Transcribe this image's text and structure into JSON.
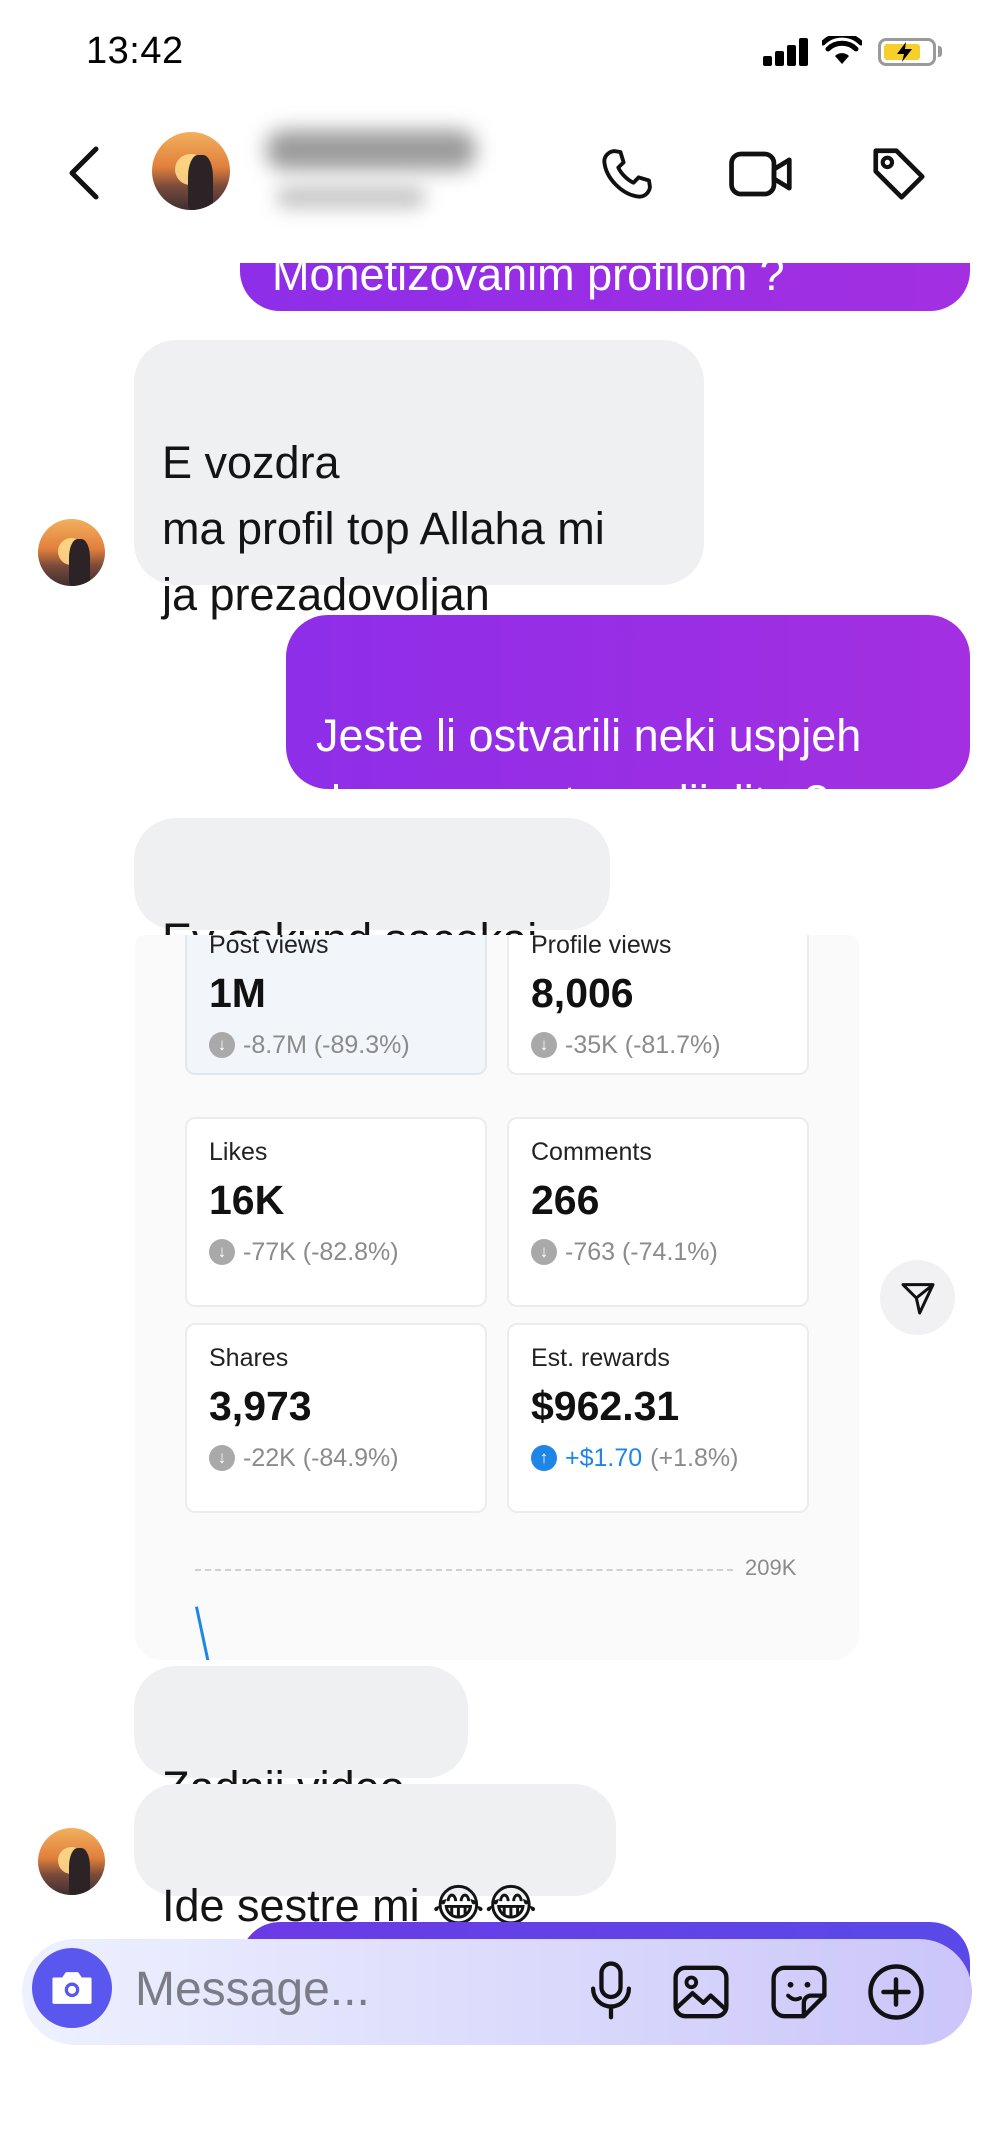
{
  "status_bar": {
    "time": "13:42"
  },
  "header": {
    "back_icon": "chevron-left-icon",
    "call_icon": "phone-icon",
    "video_icon": "video-camera-icon",
    "tag_icon": "tag-icon"
  },
  "messages": [
    {
      "side": "sent",
      "text": "Monetizovanim profilom ?",
      "partial": true
    },
    {
      "side": "received",
      "text": "E vozdra\nma profil top Allaha mi\nja prezadovoljan"
    },
    {
      "side": "sent",
      "text": "Jeste li ostvarili neki uspjeh\nda sa nama to podijelite ?"
    },
    {
      "side": "received",
      "text": "Ev sekund sacekaj"
    },
    {
      "side": "received",
      "text": "Zadnji video"
    },
    {
      "side": "received",
      "text": "Ide sestre mi 😂😂"
    }
  ],
  "shared_screenshot": {
    "stats": [
      {
        "label": "Post views",
        "value": "1M",
        "delta": "-8.7M (-89.3%)",
        "direction": "down"
      },
      {
        "label": "Profile views",
        "value": "8,006",
        "delta": "-35K (-81.7%)",
        "direction": "down"
      },
      {
        "label": "Likes",
        "value": "16K",
        "delta": "-77K (-82.8%)",
        "direction": "down"
      },
      {
        "label": "Comments",
        "value": "266",
        "delta": "-763 (-74.1%)",
        "direction": "down"
      },
      {
        "label": "Shares",
        "value": "3,973",
        "delta": "-22K (-84.9%)",
        "direction": "down"
      },
      {
        "label": "Est. rewards",
        "value": "$962.31",
        "delta_main": "+$1.70",
        "delta_pct": "(+1.8%)",
        "direction": "up"
      }
    ],
    "chart_axis_label": "209K"
  },
  "share_icon": "send-icon",
  "composer": {
    "placeholder": "Message...",
    "icons": [
      "camera-icon",
      "microphone-icon",
      "image-icon",
      "sticker-icon",
      "plus-circle-icon"
    ]
  },
  "colors": {
    "sent_bubble": "#8e2ee8",
    "received_bubble": "#eff0f2",
    "accent": "#5a57ee",
    "positive": "#1d86e6"
  }
}
